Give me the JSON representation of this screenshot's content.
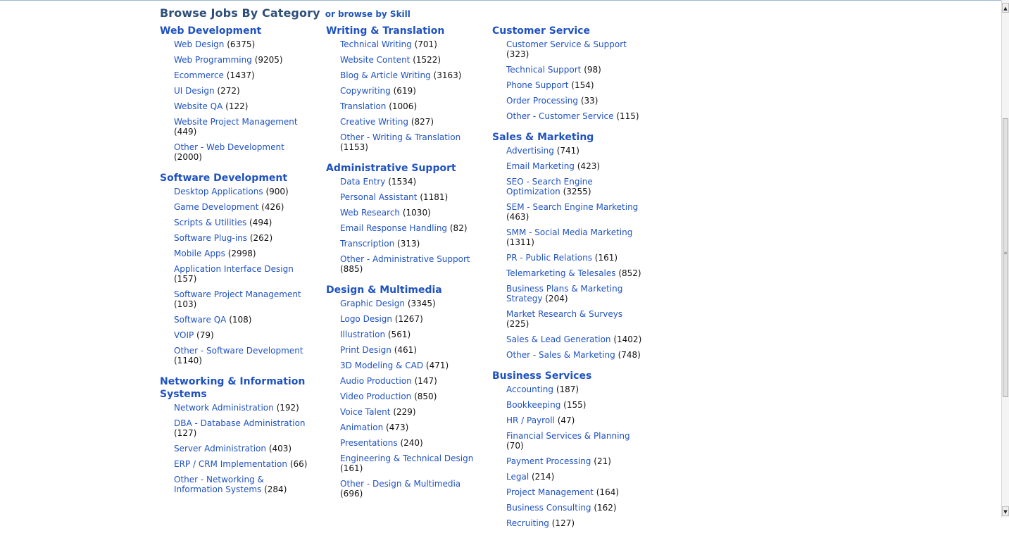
{
  "heading": {
    "title": "Browse Jobs By Category",
    "alt": "or browse by Skill"
  },
  "columns": [
    [
      {
        "title": "Web Development",
        "items": [
          {
            "label": "Web Design",
            "count": "(6375)"
          },
          {
            "label": "Web Programming",
            "count": "(9205)"
          },
          {
            "label": "Ecommerce",
            "count": "(1437)"
          },
          {
            "label": "UI Design",
            "count": "(272)"
          },
          {
            "label": "Website QA",
            "count": "(122)"
          },
          {
            "label": "Website Project Management",
            "count": "(449)"
          },
          {
            "label": "Other - Web Development",
            "count": "(2000)"
          }
        ]
      },
      {
        "title": "Software Development",
        "items": [
          {
            "label": "Desktop Applications",
            "count": "(900)"
          },
          {
            "label": "Game Development",
            "count": "(426)"
          },
          {
            "label": "Scripts & Utilities",
            "count": "(494)"
          },
          {
            "label": "Software Plug-ins",
            "count": "(262)"
          },
          {
            "label": "Mobile Apps",
            "count": "(2998)"
          },
          {
            "label": "Application Interface Design",
            "count": "(157)"
          },
          {
            "label": "Software Project Management",
            "count": "(103)"
          },
          {
            "label": "Software QA",
            "count": "(108)"
          },
          {
            "label": "VOIP",
            "count": "(79)"
          },
          {
            "label": "Other - Software Development",
            "count": "(1140)"
          }
        ]
      },
      {
        "title": "Networking & Information Systems",
        "items": [
          {
            "label": "Network Administration",
            "count": "(192)"
          },
          {
            "label": "DBA - Database Administration",
            "count": "(127)"
          },
          {
            "label": "Server Administration",
            "count": "(403)"
          },
          {
            "label": "ERP / CRM Implementation",
            "count": "(66)"
          },
          {
            "label": "Other - Networking & Information Systems",
            "count": "(284)"
          }
        ]
      }
    ],
    [
      {
        "title": "Writing & Translation",
        "items": [
          {
            "label": "Technical Writing",
            "count": "(701)"
          },
          {
            "label": "Website Content",
            "count": "(1522)"
          },
          {
            "label": "Blog & Article Writing",
            "count": "(3163)"
          },
          {
            "label": "Copywriting",
            "count": "(619)"
          },
          {
            "label": "Translation",
            "count": "(1006)"
          },
          {
            "label": "Creative Writing",
            "count": "(827)"
          },
          {
            "label": "Other - Writing & Translation",
            "count": "(1153)"
          }
        ]
      },
      {
        "title": "Administrative Support",
        "items": [
          {
            "label": "Data Entry",
            "count": "(1534)"
          },
          {
            "label": "Personal Assistant",
            "count": "(1181)"
          },
          {
            "label": "Web Research",
            "count": "(1030)"
          },
          {
            "label": "Email Response Handling",
            "count": "(82)"
          },
          {
            "label": "Transcription",
            "count": "(313)"
          },
          {
            "label": "Other - Administrative Support",
            "count": "(885)"
          }
        ]
      },
      {
        "title": "Design & Multimedia",
        "items": [
          {
            "label": "Graphic Design",
            "count": "(3345)"
          },
          {
            "label": "Logo Design",
            "count": "(1267)"
          },
          {
            "label": "Illustration",
            "count": "(561)"
          },
          {
            "label": "Print Design",
            "count": "(461)"
          },
          {
            "label": "3D Modeling & CAD",
            "count": "(471)"
          },
          {
            "label": "Audio Production",
            "count": "(147)"
          },
          {
            "label": "Video Production",
            "count": "(850)"
          },
          {
            "label": "Voice Talent",
            "count": "(229)"
          },
          {
            "label": "Animation",
            "count": "(473)"
          },
          {
            "label": "Presentations",
            "count": "(240)"
          },
          {
            "label": "Engineering & Technical Design",
            "count": "(161)"
          },
          {
            "label": "Other - Design & Multimedia",
            "count": "(696)"
          }
        ]
      }
    ],
    [
      {
        "title": "Customer Service",
        "items": [
          {
            "label": "Customer Service & Support",
            "count": "(323)"
          },
          {
            "label": "Technical Support",
            "count": "(98)"
          },
          {
            "label": "Phone Support",
            "count": "(154)"
          },
          {
            "label": "Order Processing",
            "count": "(33)"
          },
          {
            "label": "Other - Customer Service",
            "count": "(115)"
          }
        ]
      },
      {
        "title": "Sales & Marketing",
        "items": [
          {
            "label": "Advertising",
            "count": "(741)"
          },
          {
            "label": "Email Marketing",
            "count": "(423)"
          },
          {
            "label": "SEO - Search Engine Optimization",
            "count": "(3255)"
          },
          {
            "label": "SEM - Search Engine Marketing",
            "count": "(463)"
          },
          {
            "label": "SMM - Social Media Marketing",
            "count": "(1311)"
          },
          {
            "label": "PR - Public Relations",
            "count": "(161)"
          },
          {
            "label": "Telemarketing & Telesales",
            "count": "(852)"
          },
          {
            "label": "Business Plans & Marketing Strategy",
            "count": "(204)"
          },
          {
            "label": "Market Research & Surveys",
            "count": "(225)"
          },
          {
            "label": "Sales & Lead Generation",
            "count": "(1402)"
          },
          {
            "label": "Other - Sales & Marketing",
            "count": "(748)"
          }
        ]
      },
      {
        "title": "Business Services",
        "items": [
          {
            "label": "Accounting",
            "count": "(187)"
          },
          {
            "label": "Bookkeeping",
            "count": "(155)"
          },
          {
            "label": "HR / Payroll",
            "count": "(47)"
          },
          {
            "label": "Financial Services & Planning",
            "count": "(70)"
          },
          {
            "label": "Payment Processing",
            "count": "(21)"
          },
          {
            "label": "Legal",
            "count": "(214)"
          },
          {
            "label": "Project Management",
            "count": "(164)"
          },
          {
            "label": "Business Consulting",
            "count": "(162)"
          },
          {
            "label": "Recruiting",
            "count": "(127)"
          }
        ]
      }
    ]
  ],
  "scrollbar": {
    "up_icon": "arrow-up-icon",
    "down_icon": "arrow-down-icon"
  }
}
